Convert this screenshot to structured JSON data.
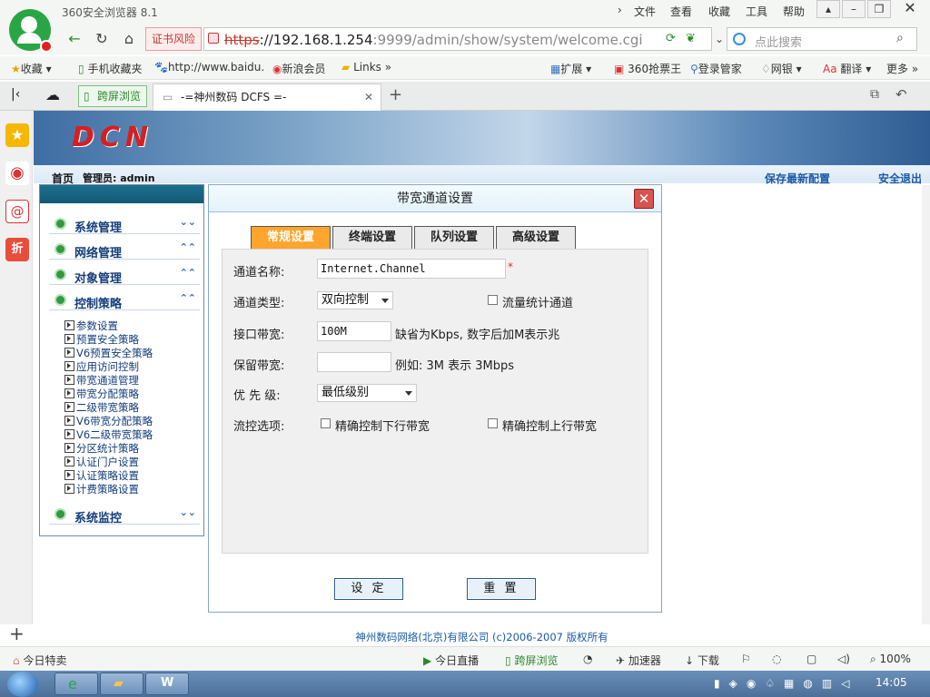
{
  "browser": {
    "title": "360安全浏览器 8.1",
    "menu": [
      "文件",
      "查看",
      "收藏",
      "工具",
      "帮助"
    ],
    "cert_warning": "证书风险",
    "url_scheme": "https",
    "url_host": "://192.168.1.254",
    "url_rest": ":9999/admin/show/system/welcome.cgi",
    "search_placeholder": "点此搜索",
    "bookmarks": [
      "收藏",
      "手机收藏夹",
      "http://www.baidu.",
      "新浪会员",
      "Links",
      "扩展",
      "360抢票王",
      "登录管家",
      "网银",
      "翻译",
      "更多"
    ],
    "split_view": "跨屏浏览",
    "tab_title": "-=神州数码 DCFS =-"
  },
  "page": {
    "brand": "DCN",
    "home": "首页",
    "admin": "管理员: admin",
    "save_config": "保存最新配置",
    "logout": "安全退出",
    "footer": "神州数码网络(北京)有限公司 (c)2006-2007 版权所有"
  },
  "menu": {
    "groups": [
      "系统管理",
      "网络管理",
      "对象管理",
      "控制策略",
      "系统监控"
    ],
    "sub_items": [
      "参数设置",
      "预置安全策略",
      "V6预置安全策略",
      "应用访问控制",
      "带宽通道管理",
      "带宽分配策略",
      "二级带宽策略",
      "V6带宽分配策略",
      "V6二级带宽策略",
      "分区统计策略",
      "认证门户设置",
      "认证策略设置",
      "计费策略设置"
    ]
  },
  "dialog": {
    "title": "带宽通道设置",
    "tabs": [
      "常规设置",
      "终端设置",
      "队列设置",
      "高级设置"
    ],
    "fields": {
      "name_label": "通道名称:",
      "name_value": "Internet.Channel",
      "required_mark": "*",
      "type_label": "通道类型:",
      "type_value": "双向控制",
      "stats_label": "流量统计通道",
      "bandwidth_label": "接口带宽:",
      "bandwidth_value": "100M",
      "bandwidth_hint": "缺省为Kbps, 数字后加M表示兆",
      "reserve_label": "保留带宽:",
      "reserve_value": "",
      "reserve_hint": "例如: 3M 表示 3Mbps",
      "priority_label": "优 先 级:",
      "priority_value": "最低级别",
      "flow_label": "流控选项:",
      "down_label": "精确控制下行带宽",
      "up_label": "精确控制上行带宽"
    },
    "set_button": "设 定",
    "reset_button": "重 置"
  },
  "statusbar": {
    "today_deal": "今日特卖",
    "live": "今日直播",
    "split": "跨屏浏览",
    "accelerator": "加速器",
    "download": "下载",
    "zoom": "100%"
  },
  "taskbar": {
    "clock": "14:05"
  }
}
